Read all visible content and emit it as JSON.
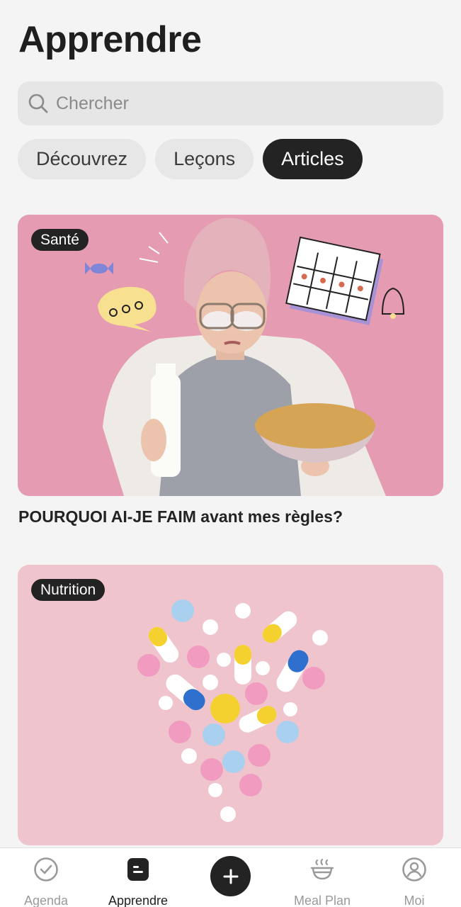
{
  "header": {
    "title": "Apprendre"
  },
  "search": {
    "placeholder": "Chercher",
    "value": ""
  },
  "tabs": [
    {
      "label": "Découvrez",
      "active": false
    },
    {
      "label": "Leçons",
      "active": false
    },
    {
      "label": "Articles",
      "active": true
    }
  ],
  "articles": [
    {
      "tag": "Santé",
      "title": "POURQUOI AI-JE FAIM avant mes règles?"
    },
    {
      "tag": "Nutrition",
      "title": ""
    }
  ],
  "bottom_nav": {
    "items": [
      {
        "label": "Agenda",
        "icon": "check-circle-icon",
        "active": false
      },
      {
        "label": "Apprendre",
        "icon": "learn-icon",
        "active": true
      },
      {
        "label": "",
        "icon": "plus-icon",
        "active": false
      },
      {
        "label": "Meal Plan",
        "icon": "bowl-icon",
        "active": false
      },
      {
        "label": "Moi",
        "icon": "user-icon",
        "active": false
      }
    ]
  },
  "colors": {
    "accent_dark": "#232323",
    "card1_bg": "#e59bb1",
    "card2_bg": "#efc4cd",
    "page_bg": "#f4f4f4"
  }
}
